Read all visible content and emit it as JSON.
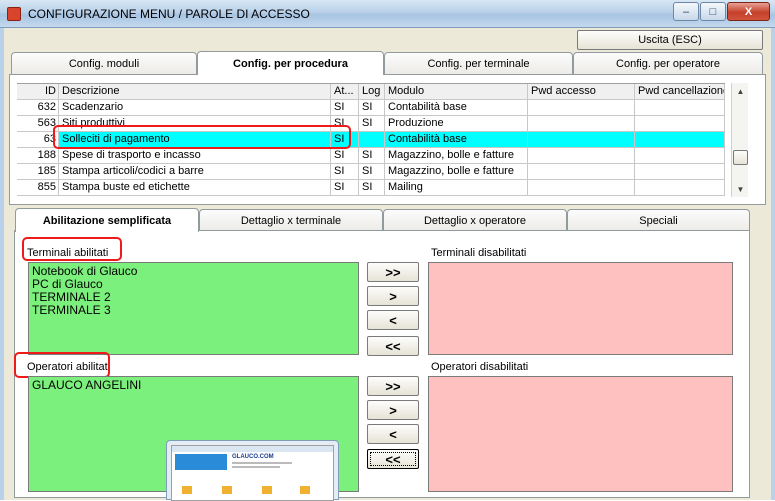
{
  "window": {
    "title": "CONFIGURAZIONE MENU / PAROLE DI ACCESSO",
    "minimize": "–",
    "maximize": "□",
    "close": "X"
  },
  "exit_button": "Uscita (ESC)",
  "top_tabs": [
    "Config. moduli",
    "Config. per procedura",
    "Config. per terminale",
    "Config. per operatore"
  ],
  "grid": {
    "headers": [
      "ID",
      "Descrizione",
      "At...",
      "Log",
      "Modulo",
      "Pwd accesso",
      "Pwd cancellazione"
    ],
    "rows": [
      {
        "id": "632",
        "desc": "Scadenzario",
        "at": "SI",
        "log": "SI",
        "modulo": "Contabilità base"
      },
      {
        "id": "563",
        "desc": "Siti produttivi",
        "at": "SI",
        "log": "SI",
        "modulo": "Produzione"
      },
      {
        "id": "63",
        "desc": "Solleciti di pagamento",
        "at": "SI",
        "log": "",
        "modulo": "Contabilità base"
      },
      {
        "id": "188",
        "desc": "Spese di trasporto e incasso",
        "at": "SI",
        "log": "SI",
        "modulo": "Magazzino, bolle e fatture"
      },
      {
        "id": "185",
        "desc": "Stampa articoli/codici a barre",
        "at": "SI",
        "log": "SI",
        "modulo": "Magazzino, bolle e fatture"
      },
      {
        "id": "855",
        "desc": "Stampa buste ed etichette",
        "at": "SI",
        "log": "SI",
        "modulo": "Mailing"
      }
    ],
    "selected_index": 2,
    "highlight_color": "#00ffff"
  },
  "bottom_tabs": [
    "Abilitazione semplificata",
    "Dettaglio x terminale",
    "Dettaglio x operatore",
    "Speciali"
  ],
  "terminali": {
    "enabled_label": "Terminali abilitati",
    "disabled_label": "Terminali disabilitati",
    "enabled": [
      "Notebook di Glauco",
      "PC di Glauco",
      "TERMINALE 2",
      "TERMINALE 3"
    ]
  },
  "operatori": {
    "enabled_label": "Operatori abilitati",
    "disabled_label": "Operatori disabilitati",
    "enabled": [
      "GLAUCO ANGELINI"
    ]
  },
  "move_buttons": [
    ">>",
    ">",
    "<",
    "<<"
  ],
  "colors": {
    "enabled_list": "#7cf07c",
    "disabled_list": "#ffc0c0",
    "annotation": "#ee1b1b"
  },
  "thumbnail": {
    "url_text": "GLAUCO.COM"
  }
}
